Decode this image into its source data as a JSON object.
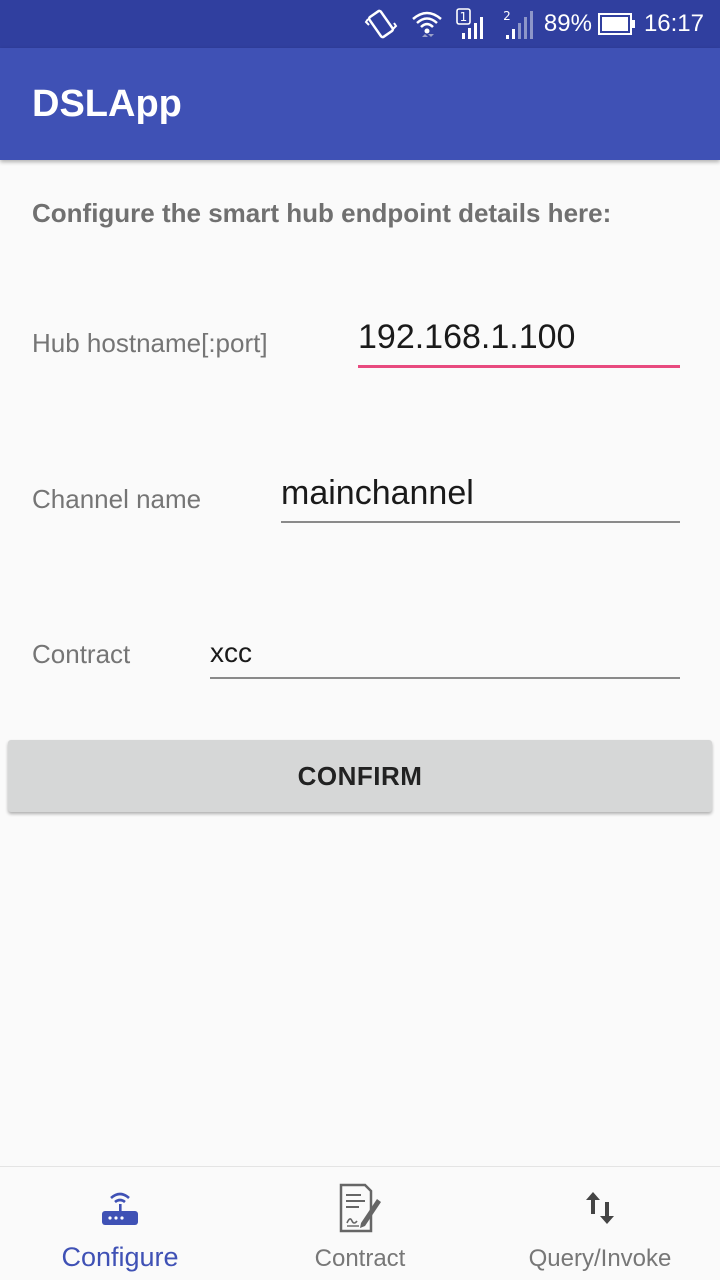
{
  "status_bar": {
    "sim1": "1",
    "sim2": "2",
    "battery": "89%",
    "time": "16:17",
    "icons": [
      "vibrate-icon",
      "wifi-icon",
      "signal-sim1-icon",
      "signal-sim2-icon",
      "battery-icon"
    ]
  },
  "app_bar": {
    "title": "DSLApp"
  },
  "form": {
    "intro": "Configure the smart hub endpoint details here:",
    "hub": {
      "label": "Hub hostname[:port]",
      "value": "192.168.1.100"
    },
    "channel": {
      "label": "Channel name",
      "value": "mainchannel"
    },
    "contract": {
      "label": "Contract",
      "value": "xcc"
    },
    "confirm_label": "CONFIRM"
  },
  "bottom_nav": {
    "items": [
      {
        "label": "Configure",
        "icon": "router-icon",
        "active": true
      },
      {
        "label": "Contract",
        "icon": "document-sign-icon",
        "active": false
      },
      {
        "label": "Query/Invoke",
        "icon": "swap-vertical-icon",
        "active": false
      }
    ]
  },
  "colors": {
    "status_bar": "#303f9f",
    "app_bar": "#3f51b5",
    "accent": "#e84a7f",
    "active_nav": "#3f51b5"
  }
}
